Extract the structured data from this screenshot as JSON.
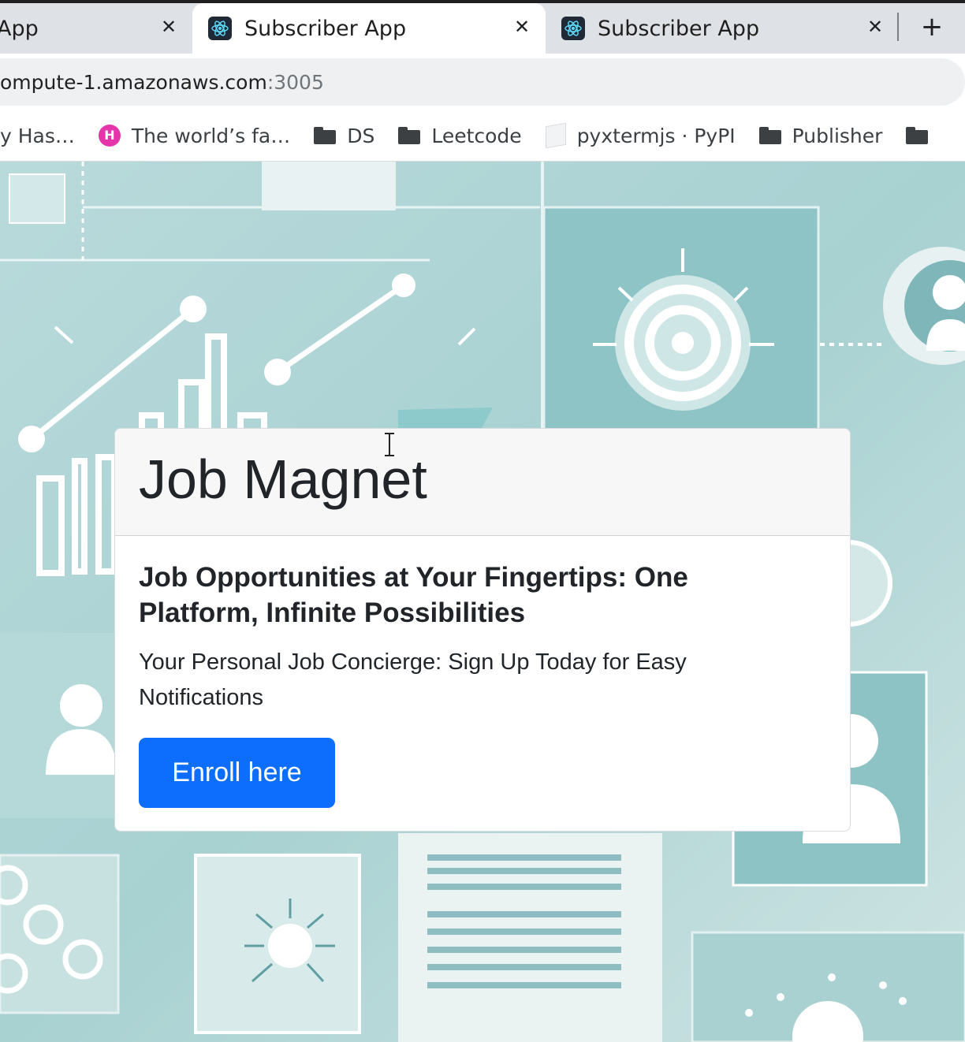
{
  "browser": {
    "tabs": [
      {
        "title": "App",
        "close_icon": "✕",
        "active": false
      },
      {
        "title": "Subscriber App",
        "close_icon": "✕",
        "active": true
      },
      {
        "title": "Subscriber App",
        "close_icon": "✕",
        "active": false
      }
    ],
    "new_tab_icon": "+",
    "url": {
      "host": "ompute-1.amazonaws.com",
      "port": ":3005"
    },
    "bookmarks": [
      {
        "label": "y Has…",
        "icon": "none"
      },
      {
        "label": "The world’s fa…",
        "icon": "hashnode-icon"
      },
      {
        "label": "DS",
        "icon": "folder-icon"
      },
      {
        "label": "Leetcode",
        "icon": "folder-icon"
      },
      {
        "label": "pyxtermjs · PyPI",
        "icon": "pypi-icon"
      },
      {
        "label": "Publisher",
        "icon": "folder-icon"
      },
      {
        "label": "",
        "icon": "folder-icon"
      }
    ]
  },
  "page": {
    "card": {
      "title": "Job Magnet",
      "subtitle": "Job Opportunities at Your Fingertips: One Platform, Infinite Possibilities",
      "text": "Your Personal Job Concierge: Sign Up Today for Easy Notifications",
      "button_label": "Enroll here"
    },
    "colors": {
      "primary_button": "#0d6efd",
      "background_teal": "#9fcccd"
    }
  }
}
